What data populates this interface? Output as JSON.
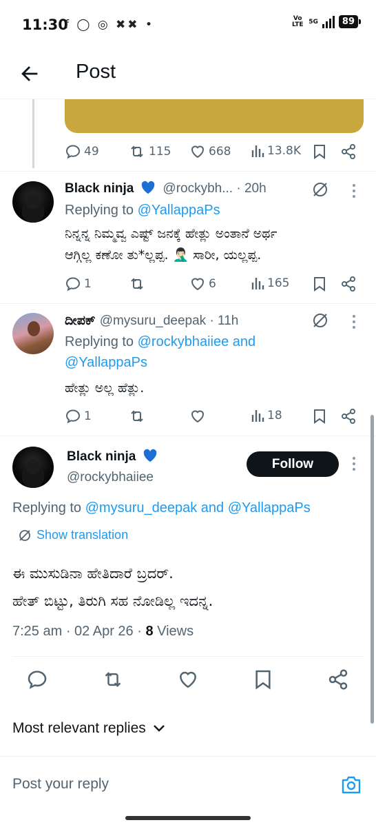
{
  "status_bar": {
    "time": "11:30",
    "app_icons": "f  ◯  ◎  ✖✖  •",
    "volte": "Vo LTE",
    "network": "5G",
    "battery": "89"
  },
  "header": {
    "title": "Post"
  },
  "parent_actions": {
    "replies": "49",
    "reposts": "115",
    "likes": "668",
    "views": "13.8K"
  },
  "replies": [
    {
      "display_name": "Black ninja",
      "handle_time": "@rockybh... · 20h",
      "replying_prefix": "Replying to",
      "replying_to": "@YallappaPs",
      "text_line1": "ನಿನ್ನನ್ನ ನಿಮ್ಮವ್ವ ಎಷ್ಟ್ ಜನಕ್ಕೆ ಹೇತ್ಲು ಅಂತಾನೆ ಅರ್ಥ",
      "text_line2": "ಆಗ್ಗಿಲ್ಲ ಕಣೋ ತು*ಲ್ಲಪ್ಪ. 🤦🏻‍♂️ ಸಾರೀ, ಯಲ್ಲಪ್ಪ.",
      "replies": "1",
      "reposts": "",
      "likes": "6",
      "views": "165"
    },
    {
      "display_name": "ದೀಪಕ್",
      "handle_time": "@mysuru_deepak · 11h",
      "replying_prefix": "Replying to",
      "replying_to": "@rockybhaiiee and",
      "replying_to_2": "@YallappaPs",
      "text_line1": "ಹೇತ್ಲು ಅಲ್ಲ ಹೆತ್ಲು.",
      "replies": "1",
      "reposts": "",
      "likes": "",
      "views": "18"
    }
  ],
  "focused_post": {
    "display_name": "Black ninja",
    "handle": "@rockybhaiiee",
    "follow_label": "Follow",
    "replying_prefix": "Replying to",
    "replying_to": "@mysuru_deepak and @YallappaPs",
    "show_translation": "Show translation",
    "text_line1": "ಈ ಮುಸುಡಿನಾ ಹೇತಿದಾರೆ ಬ್ರದರ್.",
    "text_line2": "ಹೇತ್ ಬಿಟ್ಟು, ತಿರುಗಿ ಸಹ ನೋಡಿಲ್ಲ ಇದನ್ನ.",
    "time_date": "7:25 am · 02 Apr 26 · ",
    "views_count": "8",
    "views_label": " Views"
  },
  "sort": {
    "label": "Most relevant replies"
  },
  "composer": {
    "placeholder": "Post your reply"
  },
  "colors": {
    "accent": "#1d9bf0",
    "text_secondary": "#536471",
    "follow_bg": "#0f1419",
    "media_card": "#c9a73f",
    "verified_heart": "#1d6fd6"
  }
}
